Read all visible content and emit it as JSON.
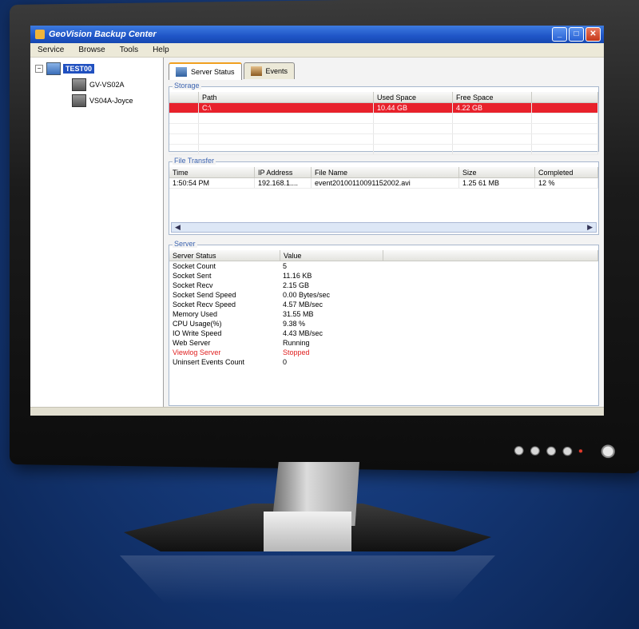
{
  "window": {
    "title": "GeoVision Backup Center",
    "controls": [
      "minimize",
      "maximize",
      "close"
    ]
  },
  "menu": [
    "Service",
    "Browse",
    "Tools",
    "Help"
  ],
  "tree": {
    "root": "TEST00",
    "children": [
      "GV-VS02A",
      "VS04A-Joyce"
    ]
  },
  "tabs": [
    {
      "label": "Server Status",
      "active": true
    },
    {
      "label": "Events",
      "active": false
    }
  ],
  "storage": {
    "title": "Storage",
    "headers": [
      "Path",
      "Used Space",
      "Free Space"
    ],
    "rows": [
      {
        "path": "C:\\",
        "used": "10.44 GB",
        "free": "4.22 GB",
        "alert": true
      }
    ]
  },
  "file_transfer": {
    "title": "File Transfer",
    "headers": [
      "Time",
      "IP Address",
      "File Name",
      "Size",
      "Completed"
    ],
    "rows": [
      {
        "time": "1:50:54 PM",
        "ip": "192.168.1....",
        "file": "event20100110091152002.avi",
        "size": "1.25 61 MB",
        "completed": "12 %"
      }
    ]
  },
  "server": {
    "title": "Server",
    "headers": [
      "Server Status",
      "Value"
    ],
    "rows": [
      {
        "name": "Socket Count",
        "value": "5",
        "error": false
      },
      {
        "name": "Socket Sent",
        "value": "11.16 KB",
        "error": false
      },
      {
        "name": "Socket Recv",
        "value": "2.15 GB",
        "error": false
      },
      {
        "name": "Socket Send Speed",
        "value": "0.00 Bytes/sec",
        "error": false
      },
      {
        "name": "Socket Recv Speed",
        "value": "4.57 MB/sec",
        "error": false
      },
      {
        "name": "Memory Used",
        "value": "31.55 MB",
        "error": false
      },
      {
        "name": "CPU Usage(%)",
        "value": "9.38 %",
        "error": false
      },
      {
        "name": "IO Write Speed",
        "value": "4.43 MB/sec",
        "error": false
      },
      {
        "name": "Web Server",
        "value": "Running",
        "error": false
      },
      {
        "name": "Viewlog Server",
        "value": "Stopped",
        "error": true
      },
      {
        "name": "Uninsert Events Count",
        "value": "0",
        "error": false
      }
    ]
  },
  "colors": {
    "alert_row": "#e8212b",
    "error_text": "#e02020",
    "titlebar": "#1f55c7",
    "panel_title": "#3c64b0"
  }
}
